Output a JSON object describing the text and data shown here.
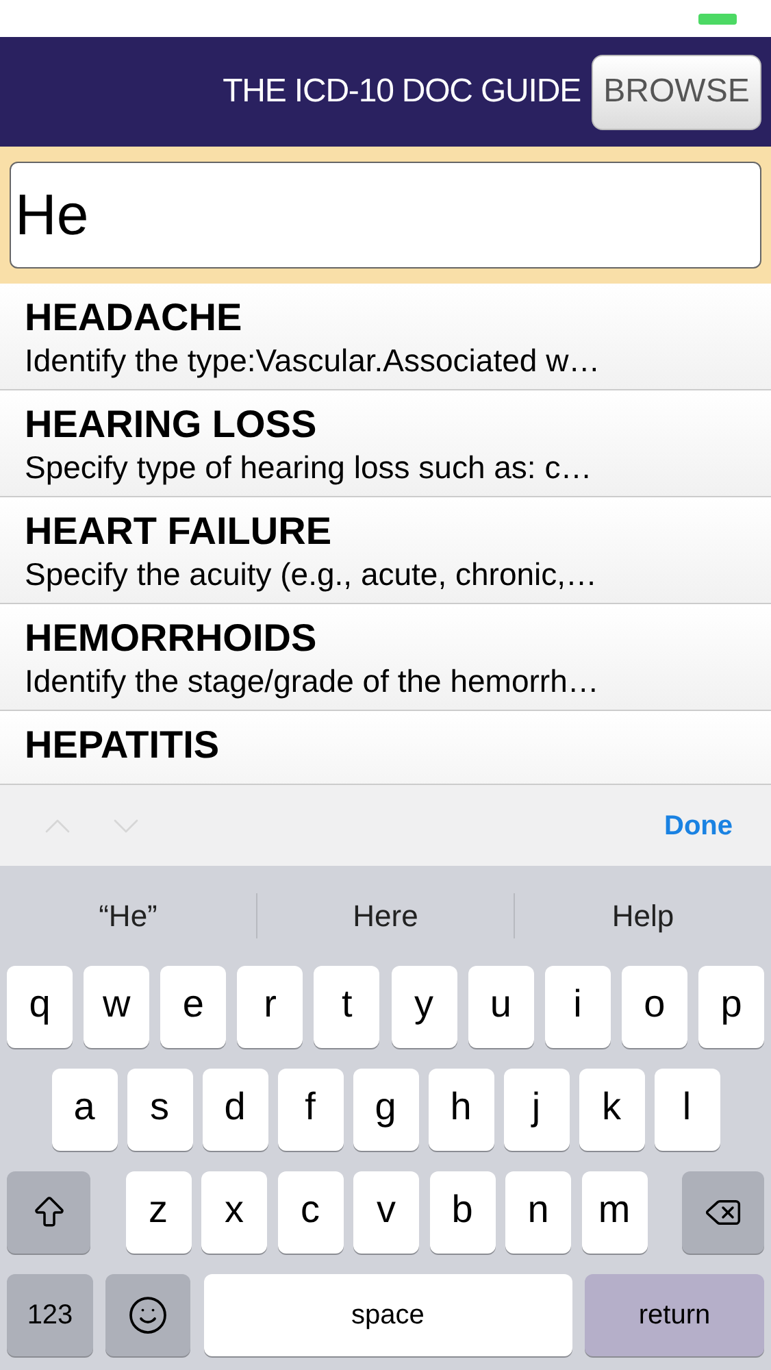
{
  "header": {
    "title": "THE ICD-10 DOC GUIDE",
    "button": "BROWSE"
  },
  "search": {
    "value": "He"
  },
  "results": [
    {
      "title": "HEADACHE",
      "description": "Identify the type:Vascular.Associated w…"
    },
    {
      "title": "HEARING LOSS",
      "description": "Specify type of hearing loss such as: c…"
    },
    {
      "title": "HEART FAILURE",
      "description": "Specify the acuity (e.g., acute, chronic,…"
    },
    {
      "title": "HEMORRHOIDS",
      "description": "Identify the stage/grade of the hemorrh…"
    },
    {
      "title": "HEPATITIS"
    }
  ],
  "toolbar": {
    "previous_enabled": false,
    "next_enabled": false,
    "done": "Done"
  },
  "keyboard": {
    "suggestions": [
      "“He”",
      "Here",
      "Help"
    ],
    "letter_rows": [
      [
        {
          "kind": "letter",
          "label": "q"
        },
        {
          "kind": "letter",
          "label": "w"
        },
        {
          "kind": "letter",
          "label": "e"
        },
        {
          "kind": "letter",
          "label": "r"
        },
        {
          "kind": "letter",
          "label": "t"
        },
        {
          "kind": "letter",
          "label": "y"
        },
        {
          "kind": "letter",
          "label": "u"
        },
        {
          "kind": "letter",
          "label": "i"
        },
        {
          "kind": "letter",
          "label": "o"
        },
        {
          "kind": "letter",
          "label": "p"
        }
      ],
      [
        {
          "kind": "letter",
          "label": "a"
        },
        {
          "kind": "letter",
          "label": "s"
        },
        {
          "kind": "letter",
          "label": "d"
        },
        {
          "kind": "letter",
          "label": "f"
        },
        {
          "kind": "letter",
          "label": "g"
        },
        {
          "kind": "letter",
          "label": "h"
        },
        {
          "kind": "letter",
          "label": "j"
        },
        {
          "kind": "letter",
          "label": "k"
        },
        {
          "kind": "letter",
          "label": "l"
        }
      ],
      [
        {
          "kind": "shift"
        },
        {
          "kind": "letter",
          "label": "z"
        },
        {
          "kind": "letter",
          "label": "x"
        },
        {
          "kind": "letter",
          "label": "c"
        },
        {
          "kind": "letter",
          "label": "v"
        },
        {
          "kind": "letter",
          "label": "b"
        },
        {
          "kind": "letter",
          "label": "n"
        },
        {
          "kind": "letter",
          "label": "m"
        },
        {
          "kind": "delete"
        }
      ]
    ],
    "bottom_keys": {
      "numbers": "123",
      "space": "space",
      "return": "return"
    }
  }
}
